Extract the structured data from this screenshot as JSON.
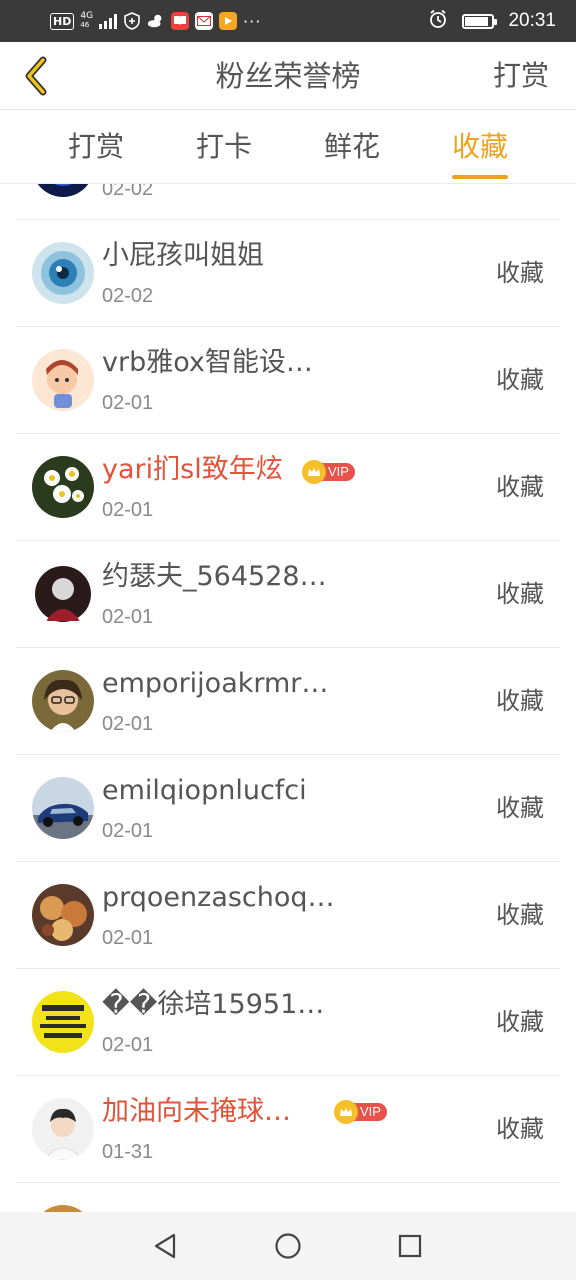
{
  "status_bar": {
    "hd": "HD",
    "network": "4G",
    "network_sub": "46",
    "time": "20:31",
    "icons": [
      "signal-icon",
      "shield-icon",
      "weather-icon",
      "book-app-icon",
      "mail-app-icon",
      "video-app-icon",
      "more-dots-icon",
      "alarm-icon",
      "battery-icon"
    ],
    "more": "···"
  },
  "header": {
    "title": "粉丝荣誉榜",
    "action": "打赏",
    "accent": "#f0a21c"
  },
  "tabs": [
    {
      "label": "打赏",
      "active": false
    },
    {
      "label": "打卡",
      "active": false
    },
    {
      "label": "鲜花",
      "active": false
    },
    {
      "label": "收藏",
      "active": true
    }
  ],
  "list": {
    "partial_top": {
      "date": "02-02"
    },
    "items": [
      {
        "name": "小屁孩叫姐姐",
        "date": "02-02",
        "action": "收藏",
        "vip": false
      },
      {
        "name": "vrb雅ox智能设…",
        "date": "02-01",
        "action": "收藏",
        "vip": false
      },
      {
        "name": "yari扪sl致年炫",
        "date": "02-01",
        "action": "收藏",
        "vip": true,
        "badge": "VIP"
      },
      {
        "name": "约瑟夫_564528…",
        "date": "02-01",
        "action": "收藏",
        "vip": false
      },
      {
        "name": "emporijoakrmr…",
        "date": "02-01",
        "action": "收藏",
        "vip": false
      },
      {
        "name": "emilqiopnlucfci",
        "date": "02-01",
        "action": "收藏",
        "vip": false
      },
      {
        "name": "prqoenzaschoq…",
        "date": "02-01",
        "action": "收藏",
        "vip": false
      },
      {
        "name": "��徐培15951…",
        "date": "02-01",
        "action": "收藏",
        "vip": false
      },
      {
        "name": "加油向未掩球…",
        "date": "01-31",
        "action": "收藏",
        "vip": true,
        "badge": "VIP"
      }
    ]
  },
  "nav_bar": {
    "icons": [
      "back-triangle-icon",
      "home-circle-icon",
      "recents-square-icon"
    ]
  }
}
